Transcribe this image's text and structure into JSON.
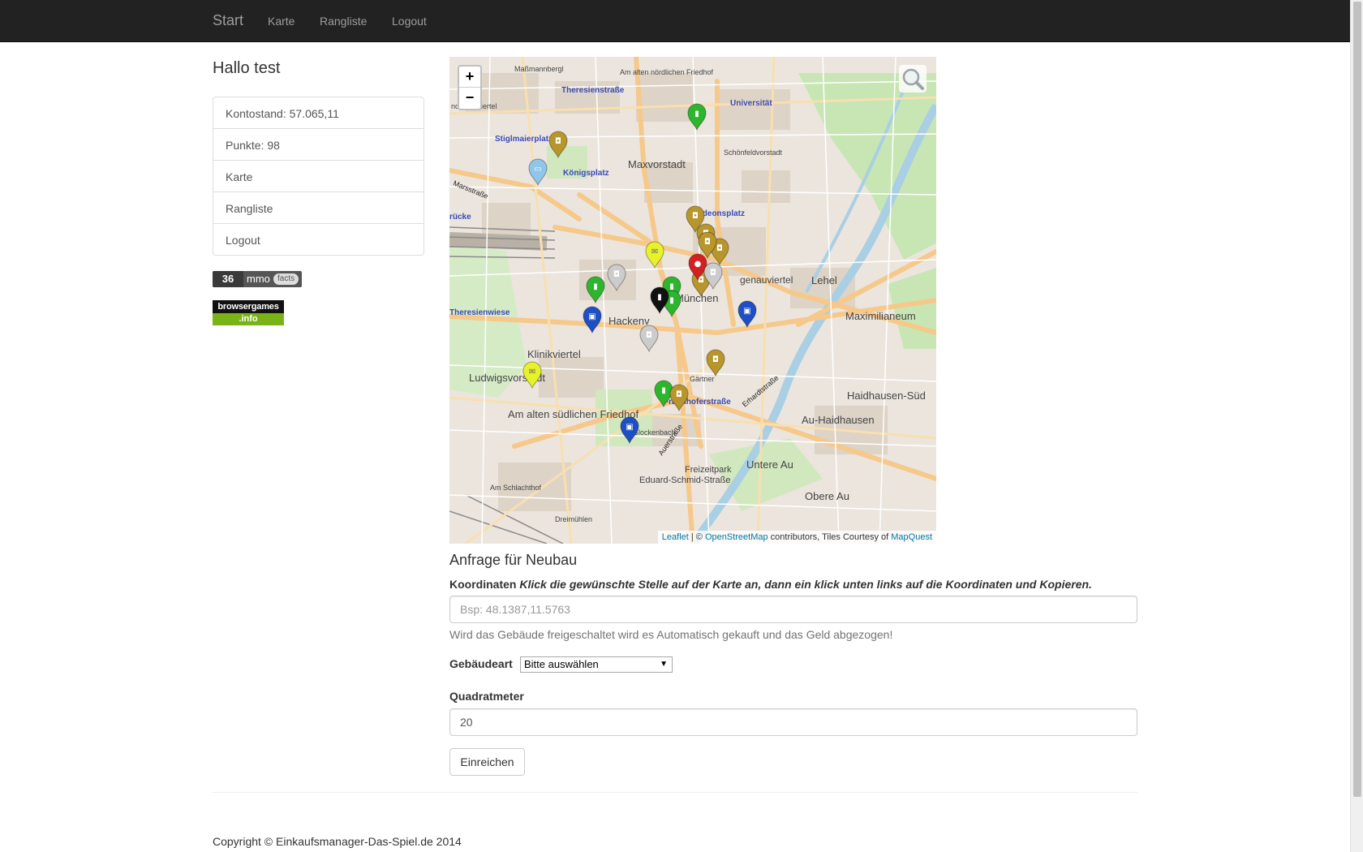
{
  "navbar": {
    "brand": "Start",
    "links": [
      "Karte",
      "Rangliste",
      "Logout"
    ]
  },
  "sidebar": {
    "greeting": "Hallo test",
    "items": [
      {
        "label": "Kontostand: 57.065,11"
      },
      {
        "label": "Punkte: 98"
      },
      {
        "label": "Karte"
      },
      {
        "label": "Rangliste"
      },
      {
        "label": "Logout"
      }
    ],
    "mmo_badge": {
      "count": "36",
      "word": "mmo",
      "suffix": "facts"
    },
    "browsergames_badge": {
      "top": "browsergames",
      "bottom": ".info"
    }
  },
  "map": {
    "zoom_in": "+",
    "zoom_out": "−",
    "attribution": {
      "leaflet": "Leaflet",
      "sep": " | © ",
      "osm": "OpenStreetMap",
      "mid": " contributors, Tiles Courtesy of ",
      "mapquest": "MapQuest"
    },
    "labels": {
      "maxvorstadt": "Maxvorstadt",
      "lehel": "Lehel",
      "klinikviertel": "Klinikviertel",
      "ludwigsvorstadt": "Ludwigsvorstadt",
      "alter_friedhof": "Am alten südlichen Friedhof",
      "haidhausen": "Haidhausen-Süd",
      "au_haidhausen": "Au-Haidhausen",
      "untere_au": "Untere Au",
      "obere_au": "Obere Au",
      "maximilian": "Maximilianeum",
      "universitat": "Universität",
      "konigsplatz": "Königsplatz",
      "stiglmaierplatz": "Stiglmaierplatz",
      "theresienwiese": "Theresienwiese",
      "odeonsplatz": "Odeonsplatz",
      "hackenviertel": "Hackenv",
      "munchen": "München",
      "graggenau": "genauviertel",
      "freizeitpark": "Freizeitpark",
      "eduard": "Eduard-Schmid-Straße",
      "am_schlachthof": "Am Schlachthof",
      "glockenbach": "Glockenbach",
      "schonfeld": "Schönfeldvorstadt",
      "sandorno": "ndorno-Viertel",
      "massmann": "Maßmannbergl",
      "nordfriedhof": "Am alten nördlichen Friedhof",
      "theresienstrasse": "Theresienstraße",
      "dreimuhlen": "Dreimühlen",
      "fraunhofer": "Fraunhoferstraße",
      "marsstrasse": "Marsstraße",
      "erhardt": "Erhardtstraße",
      "auerstrasse": "Auerstraße",
      "brucke": "rücke",
      "gartner": "Gärtner"
    },
    "markers": [
      {
        "type": "building",
        "color": "#2db52d"
      },
      {
        "type": "shop",
        "color": "#b8962b"
      },
      {
        "type": "tram",
        "color": "#8fc6ea"
      },
      {
        "type": "shop",
        "color": "#b8962b"
      },
      {
        "type": "shop",
        "color": "#b8962b"
      },
      {
        "type": "shop",
        "color": "#b8962b"
      },
      {
        "type": "shop",
        "color": "#b8962b"
      },
      {
        "type": "mail",
        "color": "#e8f22a"
      },
      {
        "type": "building",
        "color": "#2db52d"
      },
      {
        "type": "building",
        "color": "#2db52d"
      },
      {
        "type": "building",
        "color": "#2db52d"
      },
      {
        "type": "building",
        "color": "#111111"
      },
      {
        "type": "shop",
        "color": "#cccccc"
      },
      {
        "type": "shop",
        "color": "#cccccc"
      },
      {
        "type": "bag",
        "color": "#1f4fc4"
      },
      {
        "type": "bag",
        "color": "#1f4fc4"
      },
      {
        "type": "red",
        "color": "#d42020"
      },
      {
        "type": "shop",
        "color": "#b8962b"
      },
      {
        "type": "mail",
        "color": "#e8f22a"
      },
      {
        "type": "building",
        "color": "#2db52d"
      },
      {
        "type": "shop",
        "color": "#b8962b"
      },
      {
        "type": "bag",
        "color": "#1f4fc4"
      },
      {
        "type": "shop",
        "color": "#b8962b"
      },
      {
        "type": "shop",
        "color": "#cccccc"
      }
    ]
  },
  "form": {
    "title": "Anfrage für Neubau",
    "coords_label": "Koordinaten",
    "coords_help": "Klick die gewünschte Stelle auf der Karte an, dann ein klick unten links auf die Koordinaten und Kopieren.",
    "coords_placeholder": "Bsp: 48.1387,11.5763",
    "auto_help": "Wird das Gebäude freigeschaltet wird es Automatisch gekauft und das Geld abgezogen!",
    "type_label": "Gebäudeart",
    "type_selected": "Bitte auswählen",
    "area_label": "Quadratmeter",
    "area_value": "20",
    "submit_label": "Einreichen"
  },
  "footer": {
    "copyright": "Copyright © Einkaufsmanager-Das-Spiel.de 2014"
  },
  "colors": {
    "navbar_bg": "#222222",
    "navbar_text": "#9d9d9d",
    "link": "#0078a8",
    "park": "#c8e6b4",
    "water": "#a9cfe4",
    "main_road": "#f6c88a"
  }
}
